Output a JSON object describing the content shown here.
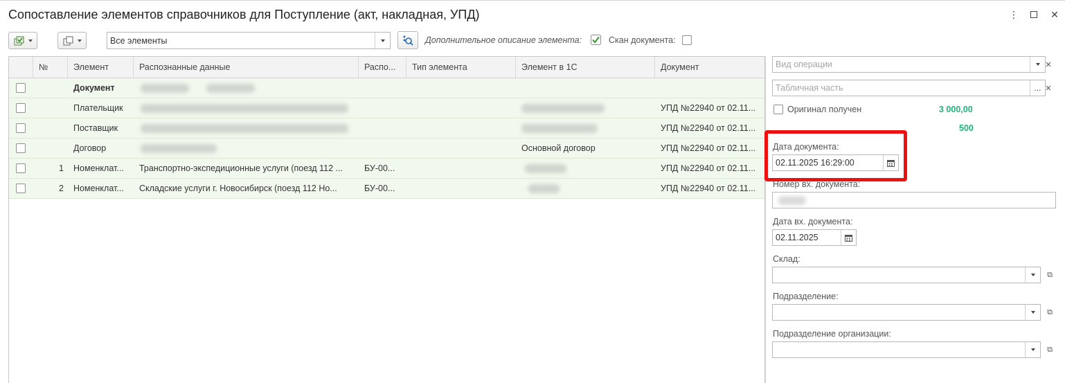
{
  "window": {
    "title": "Сопоставление элементов справочников для Поступление (акт, накладная, УПД)",
    "more_icon": "⋮",
    "maximize_icon": "☐",
    "close_icon": "✕"
  },
  "toolbar": {
    "filter_value": "Все элементы",
    "extra_description_label": "Дополнительное описание элемента:",
    "extra_description_checked": true,
    "scan_label": "Скан документа:",
    "scan_checked": false
  },
  "table": {
    "columns": [
      "№",
      "Элемент",
      "Распознанные данные",
      "Распо...",
      "Тип элемента",
      "Элемент в 1С",
      "Документ"
    ],
    "rows": [
      {
        "num": "",
        "element": "Документ",
        "recognized": "",
        "raspo": "",
        "type": "",
        "element_1c": "",
        "document": ""
      },
      {
        "num": "",
        "element": "Плательщик",
        "recognized": "",
        "raspo": "",
        "type": "",
        "element_1c": "",
        "document": "УПД №22940 от 02.11..."
      },
      {
        "num": "",
        "element": "Поставщик",
        "recognized": "",
        "raspo": "",
        "type": "",
        "element_1c": "",
        "document": "УПД №22940 от 02.11..."
      },
      {
        "num": "",
        "element": "Договор",
        "recognized": "",
        "raspo": "",
        "type": "",
        "element_1c": "Основной договор",
        "document": "УПД №22940 от 02.11..."
      },
      {
        "num": "1",
        "element": "Номенклат...",
        "recognized": "Транспортно-экспедиционные услуги (поезд 112 ...",
        "raspo": "БУ-00...",
        "type": "",
        "element_1c": "",
        "document": "УПД №22940 от 02.11..."
      },
      {
        "num": "2",
        "element": "Номенклат...",
        "recognized": "Складские услуги г. Новосибирск (поезд 112 Но...",
        "raspo": "БУ-00...",
        "type": "",
        "element_1c": "",
        "document": "УПД №22940 от 02.11..."
      }
    ]
  },
  "side": {
    "operation_placeholder": "Вид операции",
    "table_part_placeholder": "Табличная часть",
    "original_received_label": "Оригинал получен",
    "amount1": "3 000,00",
    "amount2": "500",
    "doc_date_label": "Дата документа:",
    "doc_date_value": "02.11.2025 16:29:00",
    "incoming_number_label": "Номер вх. документа:",
    "incoming_date_label": "Дата вх. документа:",
    "incoming_date_value": "02.11.2025",
    "warehouse_label": "Склад:",
    "division_label": "Подразделение:",
    "org_division_label": "Подразделение организации:"
  },
  "colors": {
    "highlight": "#ee1111",
    "amount_green": "#1fb67a",
    "row_bg": "#f1f8ee"
  }
}
